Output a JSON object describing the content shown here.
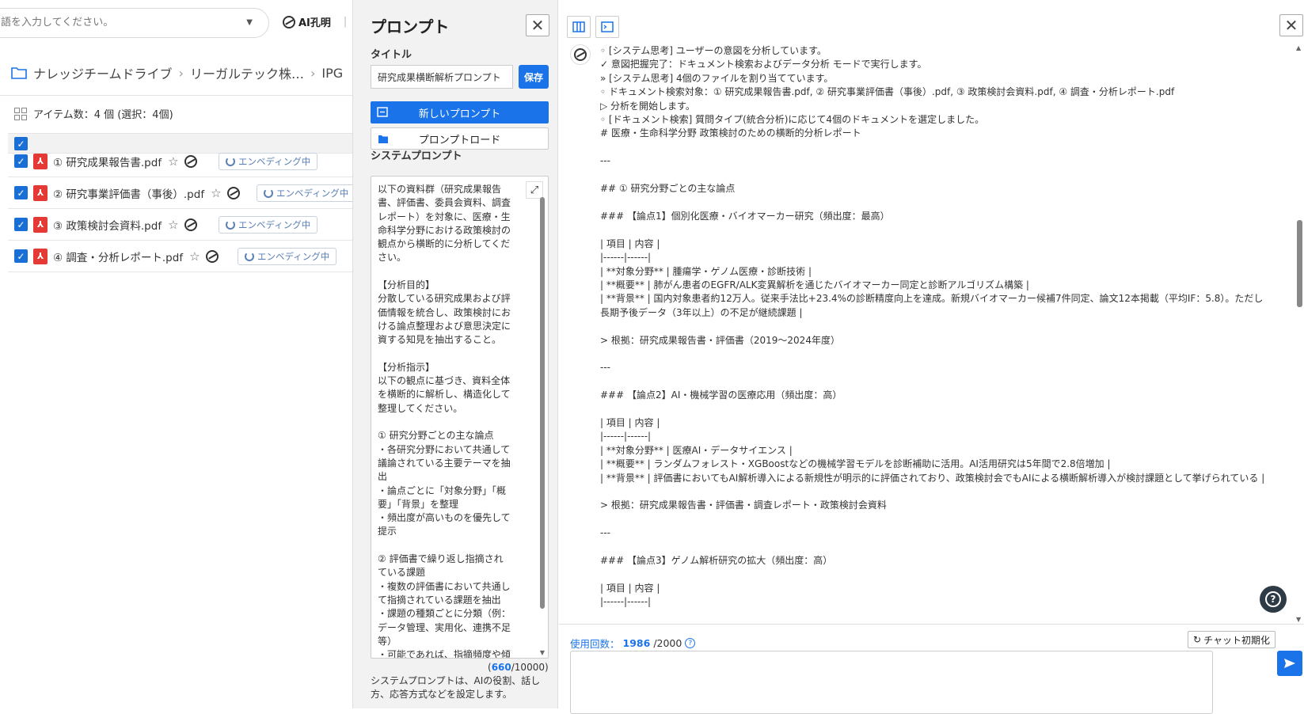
{
  "left": {
    "search_placeholder": "語を入力してください。",
    "brand": "AI孔明",
    "breadcrumb": [
      "ナレッジチームドライブ",
      "リーガルテック株…",
      "IPG"
    ],
    "item_count": "アイテム数：4 個 (選択：4個)",
    "files": [
      {
        "name": "① 研究成果報告書.pdf",
        "status": "エンベディング中"
      },
      {
        "name": "② 研究事業評価書（事後）.pdf",
        "status": "エンベディング中"
      },
      {
        "name": "③ 政策検討会資料.pdf",
        "status": "エンベディング中"
      },
      {
        "name": "④ 調査・分析レポート.pdf",
        "status": "エンベディング中"
      }
    ]
  },
  "prompt_panel": {
    "heading": "プロンプト",
    "title_label": "タイトル",
    "title_value": "研究成果横断解析プロンプト",
    "save_label": "保存",
    "new_prompt_label": "新しいプロンプト",
    "load_prompt_label": "プロンプトロード",
    "system_prompt_label": "システムプロンプト",
    "system_prompt_text": "以下の資料群（研究成果報告書、評価書、委員会資料、調査レポート）を対象に、医療・生命科学分野における政策検討の観点から横断的に分析してください。\n\n【分析目的】\n分散している研究成果および評価情報を統合し、政策検討における論点整理および意思決定に資する知見を抽出すること。\n\n【分析指示】\n以下の観点に基づき、資料全体を横断的に解析し、構造化して整理してください。\n\n① 研究分野ごとの主な論点\n・各研究分野において共通して議論されている主要テーマを抽出\n・論点ごとに「対象分野」「概要」「背景」を整理\n・頻出度が高いものを優先して提示\n\n② 評価書で繰り返し指摘されている課題\n・複数の評価書において共通して指摘されている課題を抽出\n・課題の種類ごとに分類（例：データ管理、実用化、連携不足等）\n・可能であれば、指摘頻度や傾",
    "char_count": "660",
    "char_max": "/10000)",
    "char_open": "(",
    "note": "システムプロンプトは、AIの役割、話し方、応答方式などを設定します。"
  },
  "chat": {
    "content": "◦ [システム思考] ユーザーの意図を分析しています。\n✓ 意図把握完了：ドキュメント検索およびデータ分析 モードで実行します。\n» [システム思考] 4個のファイルを割り当てています。\n◦ ドキュメント検索対象：① 研究成果報告書.pdf, ② 研究事業評価書（事後）.pdf, ③ 政策検討会資料.pdf, ④ 調査・分析レポート.pdf\n▷ 分析を開始します。\n◦ [ドキュメント検索] 質問タイプ(統合分析)に応じて4個のドキュメントを選定しました。\n# 医療・生命科学分野 政策検討のための横断的分析レポート\n\n---\n\n## ① 研究分野ごとの主な論点\n\n### 【論点1】個別化医療・バイオマーカー研究（頻出度：最高）\n\n| 項目 | 内容 |\n|------|------|\n| **対象分野** | 腫瘍学・ゲノム医療・診断技術 |\n| **概要** | 肺がん患者のEGFR/ALK変異解析を通じたバイオマーカー同定と診断アルゴリズム構築 |\n| **背景** | 国内対象患者約12万人。従来手法比+23.4%の診断精度向上を達成。新規バイオマーカー候補7件同定、論文12本掲載（平均IF：5.8）。ただし長期予後データ（3年以上）の不足が継続課題 |\n\n> 根拠：研究成果報告書・評価書（2019〜2024年度）\n\n---\n\n### 【論点2】AI・機械学習の医療応用（頻出度：高）\n\n| 項目 | 内容 |\n|------|------|\n| **対象分野** | 医療AI・データサイエンス |\n| **概要** | ランダムフォレスト・XGBoostなどの機械学習モデルを診断補助に活用。AI活用研究は5年間で2.8倍増加 |\n| **背景** | 評価書においてもAI解析導入による新規性が明示的に評価されており、政策検討会でもAIによる横断解析導入が検討課題として挙げられている |\n\n> 根拠：研究成果報告書・評価書・調査レポート・政策検討会資料\n\n---\n\n### 【論点3】ゲノム解析研究の拡大（頻出度：高）\n\n| 項目 | 内容 |\n|------|------|",
    "usage_label": "使用回数：",
    "usage_count": "1986",
    "usage_max": "/2000",
    "reset_label": "チャット初期化"
  },
  "colors": {
    "accent": "#1a73e8",
    "pdf_red": "#e53935",
    "embed_text": "#5a7fb5",
    "panel_bg": "#f2f2f2"
  }
}
